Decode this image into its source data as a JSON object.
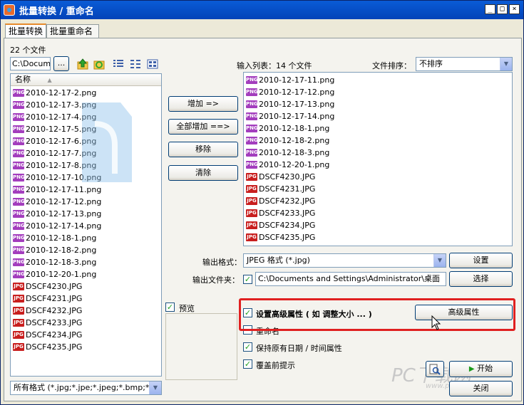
{
  "window": {
    "title": "批量转换 / 重命名",
    "min": "_",
    "max": "□",
    "close": "×"
  },
  "tabs": [
    {
      "label": "批量转换"
    },
    {
      "label": "批量重命名"
    }
  ],
  "browser": {
    "count_label": "22 个文件",
    "path_value": "C:\\Docume",
    "browse_label": "...",
    "column_name": "名称",
    "files": [
      {
        "name": "2010-12-17-2.png",
        "type": "PNG"
      },
      {
        "name": "2010-12-17-3.png",
        "type": "PNG"
      },
      {
        "name": "2010-12-17-4.png",
        "type": "PNG"
      },
      {
        "name": "2010-12-17-5.png",
        "type": "PNG"
      },
      {
        "name": "2010-12-17-6.png",
        "type": "PNG"
      },
      {
        "name": "2010-12-17-7.png",
        "type": "PNG"
      },
      {
        "name": "2010-12-17-8.png",
        "type": "PNG"
      },
      {
        "name": "2010-12-17-10.png",
        "type": "PNG"
      },
      {
        "name": "2010-12-17-11.png",
        "type": "PNG"
      },
      {
        "name": "2010-12-17-12.png",
        "type": "PNG"
      },
      {
        "name": "2010-12-17-13.png",
        "type": "PNG"
      },
      {
        "name": "2010-12-17-14.png",
        "type": "PNG"
      },
      {
        "name": "2010-12-18-1.png",
        "type": "PNG"
      },
      {
        "name": "2010-12-18-2.png",
        "type": "PNG"
      },
      {
        "name": "2010-12-18-3.png",
        "type": "PNG"
      },
      {
        "name": "2010-12-20-1.png",
        "type": "PNG"
      },
      {
        "name": "DSCF4230.JPG",
        "type": "JPG"
      },
      {
        "name": "DSCF4231.JPG",
        "type": "JPG"
      },
      {
        "name": "DSCF4232.JPG",
        "type": "JPG"
      },
      {
        "name": "DSCF4233.JPG",
        "type": "JPG"
      },
      {
        "name": "DSCF4234.JPG",
        "type": "JPG"
      },
      {
        "name": "DSCF4235.JPG",
        "type": "JPG"
      }
    ],
    "filter_value": "所有格式 (*.jpg;*.jpe;*.jpeg;*.bmp;*."
  },
  "actions": {
    "add": "增加 =>",
    "add_all": "全部增加 ==>",
    "remove": "移除",
    "clear": "清除"
  },
  "input_list": {
    "label": "输入列表：14 个文件",
    "sort_label": "文件排序：",
    "sort_value": "不排序",
    "files": [
      {
        "name": "2010-12-17-11.png",
        "type": "PNG"
      },
      {
        "name": "2010-12-17-12.png",
        "type": "PNG"
      },
      {
        "name": "2010-12-17-13.png",
        "type": "PNG"
      },
      {
        "name": "2010-12-17-14.png",
        "type": "PNG"
      },
      {
        "name": "2010-12-18-1.png",
        "type": "PNG"
      },
      {
        "name": "2010-12-18-2.png",
        "type": "PNG"
      },
      {
        "name": "2010-12-18-3.png",
        "type": "PNG"
      },
      {
        "name": "2010-12-20-1.png",
        "type": "PNG"
      },
      {
        "name": "DSCF4230.JPG",
        "type": "JPG"
      },
      {
        "name": "DSCF4231.JPG",
        "type": "JPG"
      },
      {
        "name": "DSCF4232.JPG",
        "type": "JPG"
      },
      {
        "name": "DSCF4233.JPG",
        "type": "JPG"
      },
      {
        "name": "DSCF4234.JPG",
        "type": "JPG"
      },
      {
        "name": "DSCF4235.JPG",
        "type": "JPG"
      }
    ]
  },
  "output": {
    "format_label": "输出格式：",
    "format_value": "JPEG 格式 (*.jpg)",
    "settings_button": "设置",
    "folder_label": "输出文件夹：",
    "folder_value": "C:\\Documents and Settings\\Administrator\\桌面",
    "choose_button": "选择"
  },
  "preview_label": "预览",
  "options": {
    "advanced_label": "设置高级属性 ( 如 调整大小 ... )",
    "advanced_button": "高级属性",
    "rename_label": "重命名",
    "keep_date_label": "保持原有日期 / 时间属性",
    "overwrite_label": "覆盖前提示"
  },
  "footer": {
    "start": "开始",
    "close": "关闭"
  },
  "watermark": {
    "site": "PC下载网",
    "url": "www.pcsoft.com.cn"
  }
}
